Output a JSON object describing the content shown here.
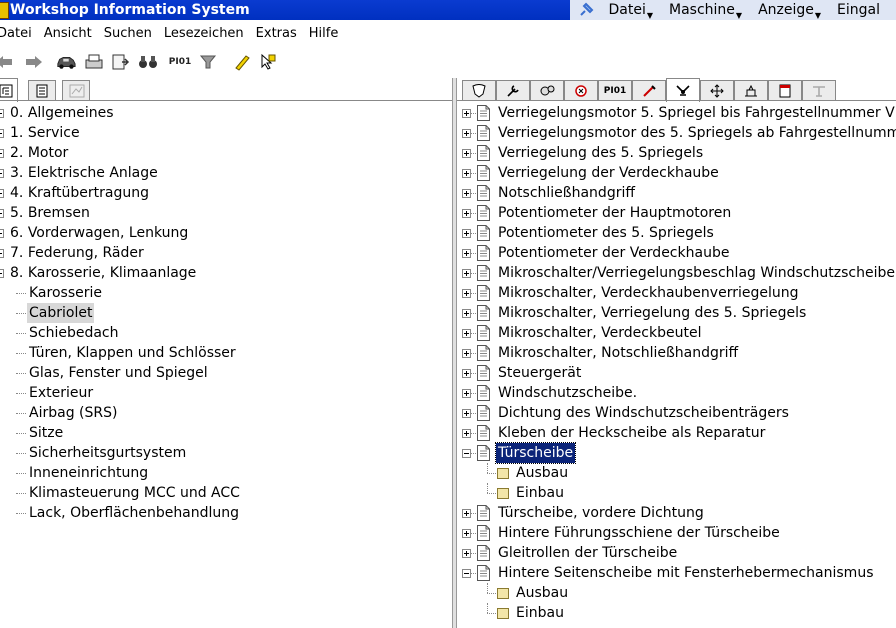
{
  "window": {
    "title": "Workshop Information System"
  },
  "right_menu": [
    "Datei",
    "Maschine",
    "Anzeige",
    "Eingal"
  ],
  "menu": [
    "Datei",
    "Ansicht",
    "Suchen",
    "Lesezeichen",
    "Extras",
    "Hilfe"
  ],
  "toolbar": {
    "pi_label": "PI01"
  },
  "right_tabs": {
    "pi_label": "PI01"
  },
  "left_tree": [
    {
      "prefix": "0.",
      "label": "Allgemeines",
      "level": 0
    },
    {
      "prefix": "1.",
      "label": "Service",
      "level": 0
    },
    {
      "prefix": "2.",
      "label": "Motor",
      "level": 0
    },
    {
      "prefix": "3.",
      "label": "Elektrische Anlage",
      "level": 0
    },
    {
      "prefix": "4.",
      "label": "Kraftübertragung",
      "level": 0
    },
    {
      "prefix": "5.",
      "label": "Bremsen",
      "level": 0
    },
    {
      "prefix": "6.",
      "label": "Vorderwagen, Lenkung",
      "level": 0
    },
    {
      "prefix": "7.",
      "label": "Federung, Räder",
      "level": 0
    },
    {
      "prefix": "8.",
      "label": "Karosserie, Klimaanlage",
      "level": 0
    },
    {
      "label": "Karosserie",
      "level": 1
    },
    {
      "label": "Cabriolet",
      "level": 1,
      "selected": true
    },
    {
      "label": "Schiebedach",
      "level": 1
    },
    {
      "label": "Türen, Klappen und Schlösser",
      "level": 1
    },
    {
      "label": "Glas, Fenster und Spiegel",
      "level": 1
    },
    {
      "label": "Exterieur",
      "level": 1
    },
    {
      "label": "Airbag (SRS)",
      "level": 1
    },
    {
      "label": "Sitze",
      "level": 1
    },
    {
      "label": "Sicherheitsgurtsystem",
      "level": 1
    },
    {
      "label": "Inneneinrichtung",
      "level": 1
    },
    {
      "label": "Klimasteuerung MCC und ACC",
      "level": 1
    },
    {
      "label": "Lack, Oberflächenbehandlung",
      "level": 1
    }
  ],
  "right_tree": [
    {
      "label": "Verriegelungsmotor 5. Spriegel bis Fahrgestellnummer V",
      "level": 0,
      "state": "collapsed"
    },
    {
      "label": "Verriegelungsmotor des 5. Spriegels ab Fahrgestellnumm",
      "level": 0,
      "state": "collapsed"
    },
    {
      "label": "Verriegelung des 5. Spriegels",
      "level": 0,
      "state": "collapsed"
    },
    {
      "label": "Verriegelung der Verdeckhaube",
      "level": 0,
      "state": "collapsed"
    },
    {
      "label": "Notschließhandgriff",
      "level": 0,
      "state": "collapsed"
    },
    {
      "label": "Potentiometer der Hauptmotoren",
      "level": 0,
      "state": "collapsed"
    },
    {
      "label": "Potentiometer des 5. Spriegels",
      "level": 0,
      "state": "collapsed"
    },
    {
      "label": "Potentiometer der Verdeckhaube",
      "level": 0,
      "state": "collapsed"
    },
    {
      "label": "Mikroschalter/Verriegelungsbeschlag Windschutzscheiber",
      "level": 0,
      "state": "collapsed"
    },
    {
      "label": "Mikroschalter, Verdeckhaubenverriegelung",
      "level": 0,
      "state": "collapsed"
    },
    {
      "label": "Mikroschalter, Verriegelung des 5. Spriegels",
      "level": 0,
      "state": "collapsed"
    },
    {
      "label": "Mikroschalter, Verdeckbeutel",
      "level": 0,
      "state": "collapsed"
    },
    {
      "label": "Mikroschalter, Notschließhandgriff",
      "level": 0,
      "state": "collapsed"
    },
    {
      "label": "Steuergerät",
      "level": 0,
      "state": "collapsed"
    },
    {
      "label": "Windschutzscheibe.",
      "level": 0,
      "state": "collapsed"
    },
    {
      "label": "Dichtung des Windschutzscheibenträgers",
      "level": 0,
      "state": "collapsed"
    },
    {
      "label": "Kleben der Heckscheibe als Reparatur",
      "level": 0,
      "state": "collapsed"
    },
    {
      "label": "Türscheibe",
      "level": 0,
      "state": "expanded",
      "focused": true
    },
    {
      "label": "Ausbau",
      "level": 1
    },
    {
      "label": "Einbau",
      "level": 1
    },
    {
      "label": "Türscheibe, vordere Dichtung",
      "level": 0,
      "state": "collapsed"
    },
    {
      "label": "Hintere Führungsschiene der Türscheibe",
      "level": 0,
      "state": "collapsed"
    },
    {
      "label": "Gleitrollen der Türscheibe",
      "level": 0,
      "state": "collapsed"
    },
    {
      "label": "Hintere Seitenscheibe mit Fensterhebermechanismus",
      "level": 0,
      "state": "expanded"
    },
    {
      "label": "Ausbau",
      "level": 1
    },
    {
      "label": "Einbau",
      "level": 1
    }
  ]
}
